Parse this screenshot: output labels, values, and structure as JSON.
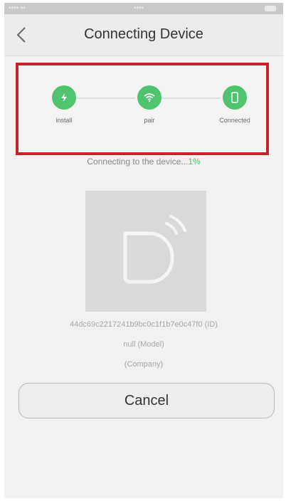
{
  "status_bar": {
    "left_text": "•••• ••",
    "clock": "••••"
  },
  "header": {
    "title": "Connecting Device",
    "back_icon": "chevron-left-icon"
  },
  "steps": [
    {
      "label": "install",
      "icon": "lightning-icon",
      "done": true
    },
    {
      "label": "pair",
      "icon": "wifi-icon",
      "done": true
    },
    {
      "label": "Connected",
      "icon": "phone-icon",
      "done": true
    }
  ],
  "progress": {
    "text": "Connecting to the device...",
    "percent": "1%"
  },
  "device": {
    "image_icon": "device-signal-icon",
    "id_line": "44dc69c2217241b9bc0c1f1b7e0c47f0 (ID)",
    "model_line": "null (Model)",
    "company_line": "(Company)"
  },
  "actions": {
    "cancel_label": "Cancel"
  },
  "colors": {
    "accent_green": "#4fc46e",
    "highlight_red": "#c6202c"
  }
}
